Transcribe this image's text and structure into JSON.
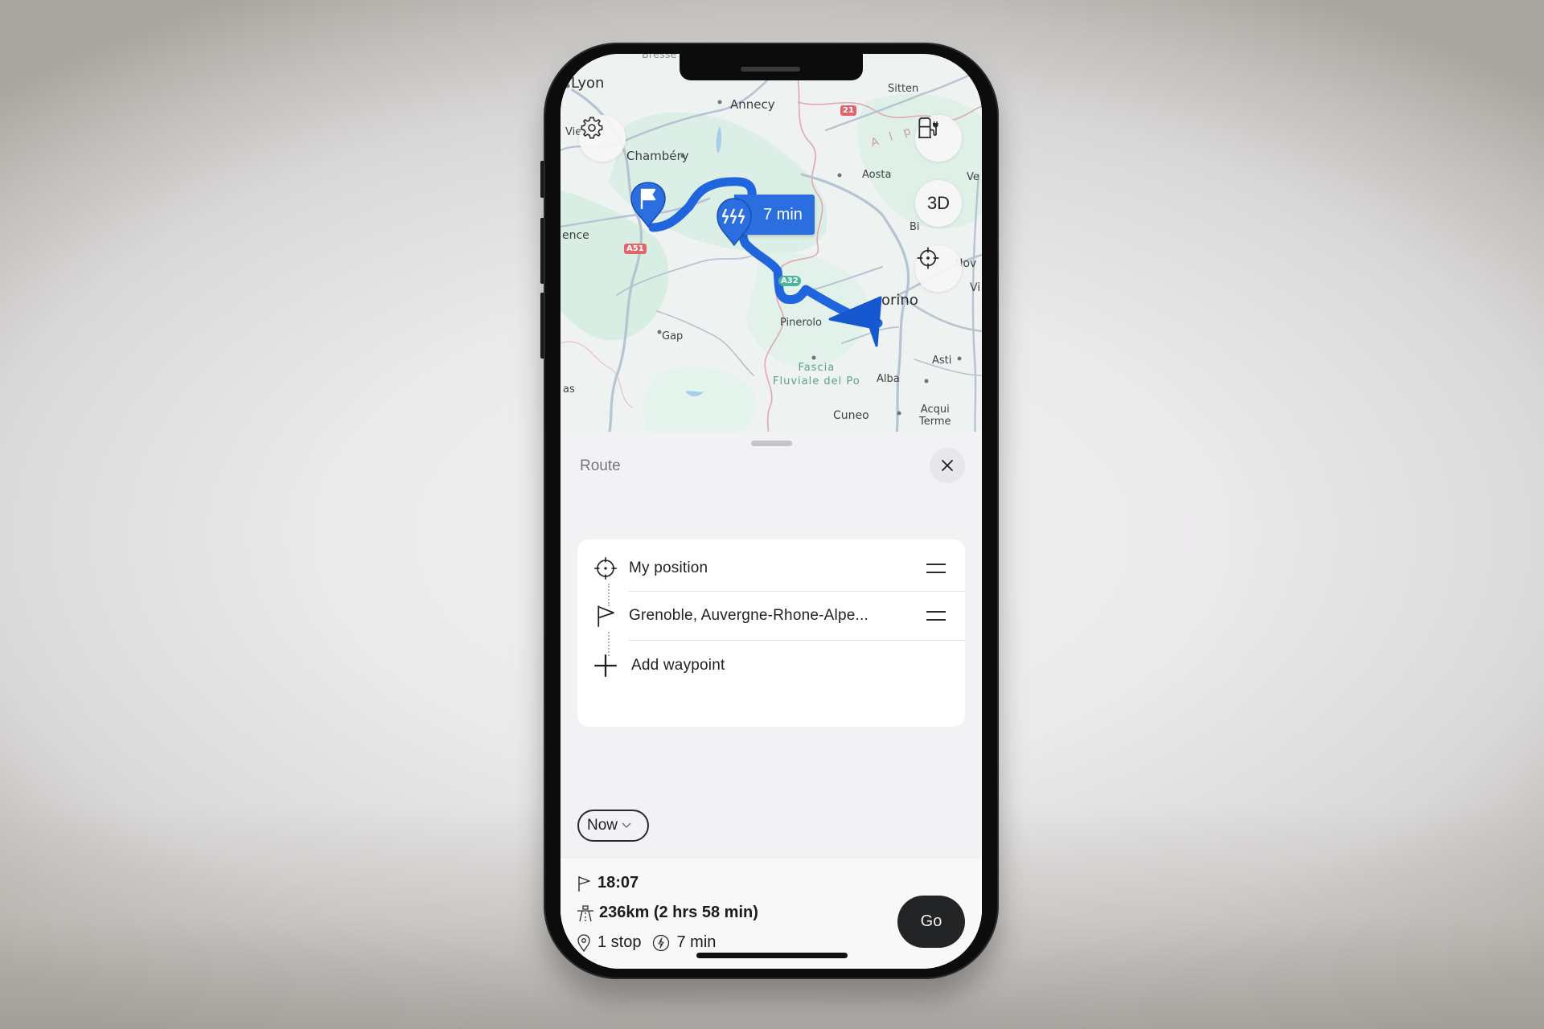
{
  "map": {
    "labels": {
      "lyon": "Lyon",
      "vienne": "Vien.",
      "annecy": "Annecy",
      "sitten": "Sitten",
      "chambery": "Chambéry",
      "aosta": "Aosta",
      "alps": "A l p",
      "ve": "Ve",
      "valence": "ence",
      "bi": "Bi",
      "nov": "Nov",
      "torino": "orino",
      "vi": "Vi",
      "pinerolo": "Pinerolo",
      "gap": "Gap",
      "park": "Fascia\nFluviale del Po",
      "asti": "Asti",
      "alba": "Alba",
      "as": "as",
      "cuneo": "Cuneo",
      "acqui": "Acqui\nTerme",
      "bresse": "Bresse"
    },
    "road_badges": {
      "a51": "A51",
      "a32": "A32",
      "r21": "21"
    },
    "charge_stop_duration": "7 min",
    "buttons": {
      "settings": "settings",
      "charging": "charging-stations",
      "view_3d": "3D",
      "recenter": "recenter"
    },
    "colors": {
      "route": "#1f66de",
      "marker": "#2b6ee0",
      "road_badge_red": "#e0656c",
      "road_badge_green": "#4db39c"
    }
  },
  "sheet": {
    "title": "Route",
    "close": "close",
    "waypoints": [
      {
        "icon": "crosshair-icon",
        "label": "My position"
      },
      {
        "icon": "flag-icon",
        "label": "Grenoble, Auvergne-Rhone-Alpe..."
      },
      {
        "icon": "plus-icon",
        "label": "Add waypoint"
      }
    ],
    "departure": {
      "selected": "Now"
    }
  },
  "summary": {
    "arrival_time": "18:07",
    "distance_duration": "236km (2 hrs 58 min)",
    "stops": "1 stop",
    "charge_time": "7 min",
    "go_label": "Go"
  }
}
